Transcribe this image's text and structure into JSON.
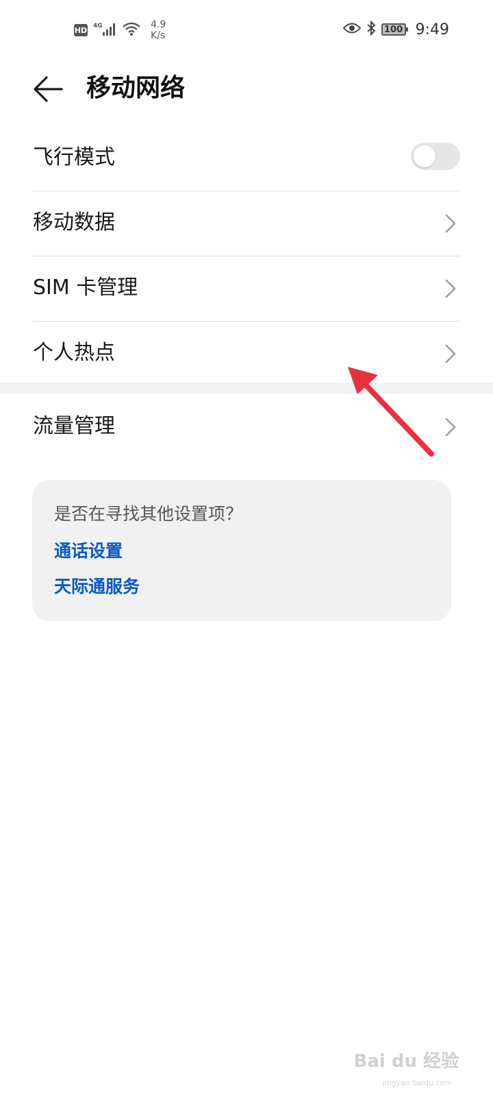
{
  "status_bar": {
    "hd_label": "HD",
    "network_type": "4G",
    "speed_value": "4.9",
    "speed_unit": "K/s",
    "battery_level": "100",
    "time": "9:49",
    "icons": [
      "signal-icon",
      "wifi-icon",
      "eye-icon",
      "bluetooth-icon",
      "battery-icon"
    ]
  },
  "header": {
    "title": "移动网络"
  },
  "settings": {
    "airplane_mode": {
      "label": "飞行模式",
      "on": false
    },
    "items": [
      {
        "label": "移动数据"
      },
      {
        "label": "SIM 卡管理"
      },
      {
        "label": "个人热点"
      }
    ],
    "traffic": {
      "label": "流量管理"
    }
  },
  "suggestions": {
    "question": "是否在寻找其他设置项？",
    "links": [
      {
        "label": "通话设置"
      },
      {
        "label": "天际通服务"
      }
    ]
  },
  "colors": {
    "link": "#0a59c6",
    "annotation_arrow": "#e8303f",
    "toggle_off": "#e6e6e6"
  },
  "watermark": {
    "main": "Bai du 经验",
    "sub": "jingyan.baidu.com"
  }
}
